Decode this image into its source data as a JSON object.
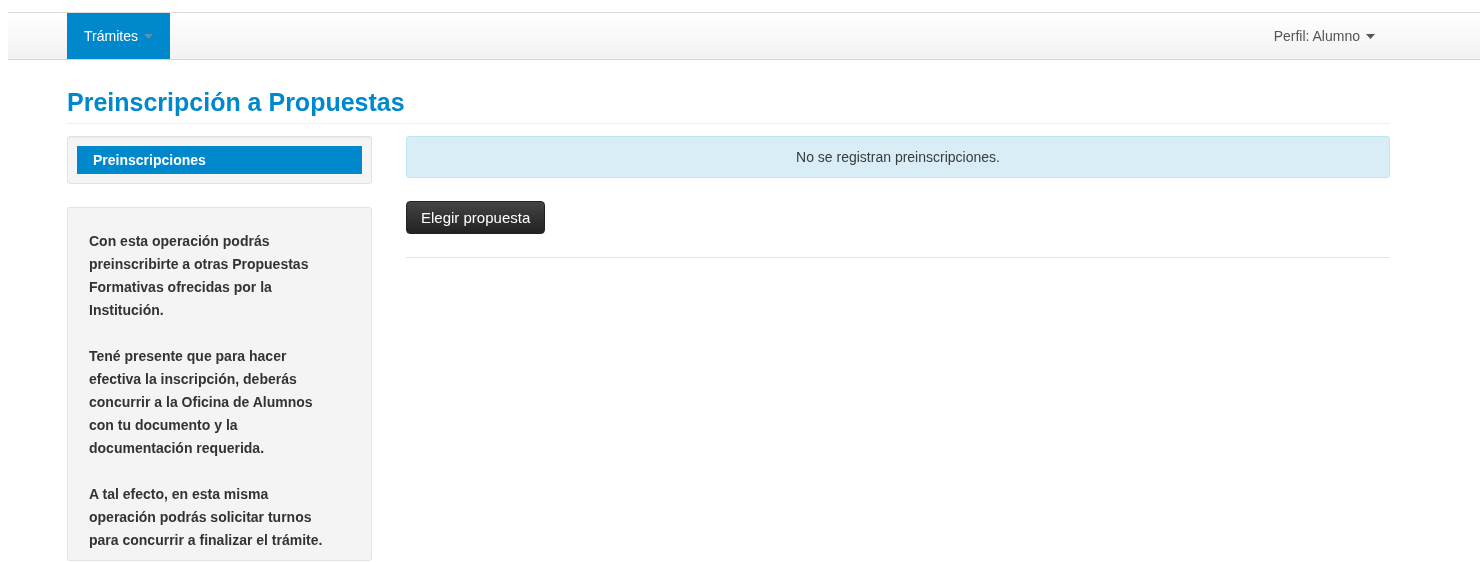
{
  "navbar": {
    "menus": [
      {
        "label": "Trámites",
        "selected": true
      }
    ],
    "profile": "Perfil: Alumno"
  },
  "page_title": "Preinscripción a Propuestas",
  "sidebar": {
    "items": [
      {
        "label": "Preinscripciones",
        "selected": true
      }
    ],
    "help": [
      "Con esta operación podrás preinscribirte a otras Propuestas Formativas ofrecidas por la Institución.",
      "Tené presente que para hacer efectiva la inscripción, deberás concurrir a la Oficina de Alumnos con tu documento y la documentación requerida.",
      "A tal efecto, en esta misma operación podrás solicitar turnos para concurrir a finalizar el trámite."
    ]
  },
  "alert": "No se registran preinscripciones.",
  "buttons": [
    "Elegir propuesta"
  ]
}
